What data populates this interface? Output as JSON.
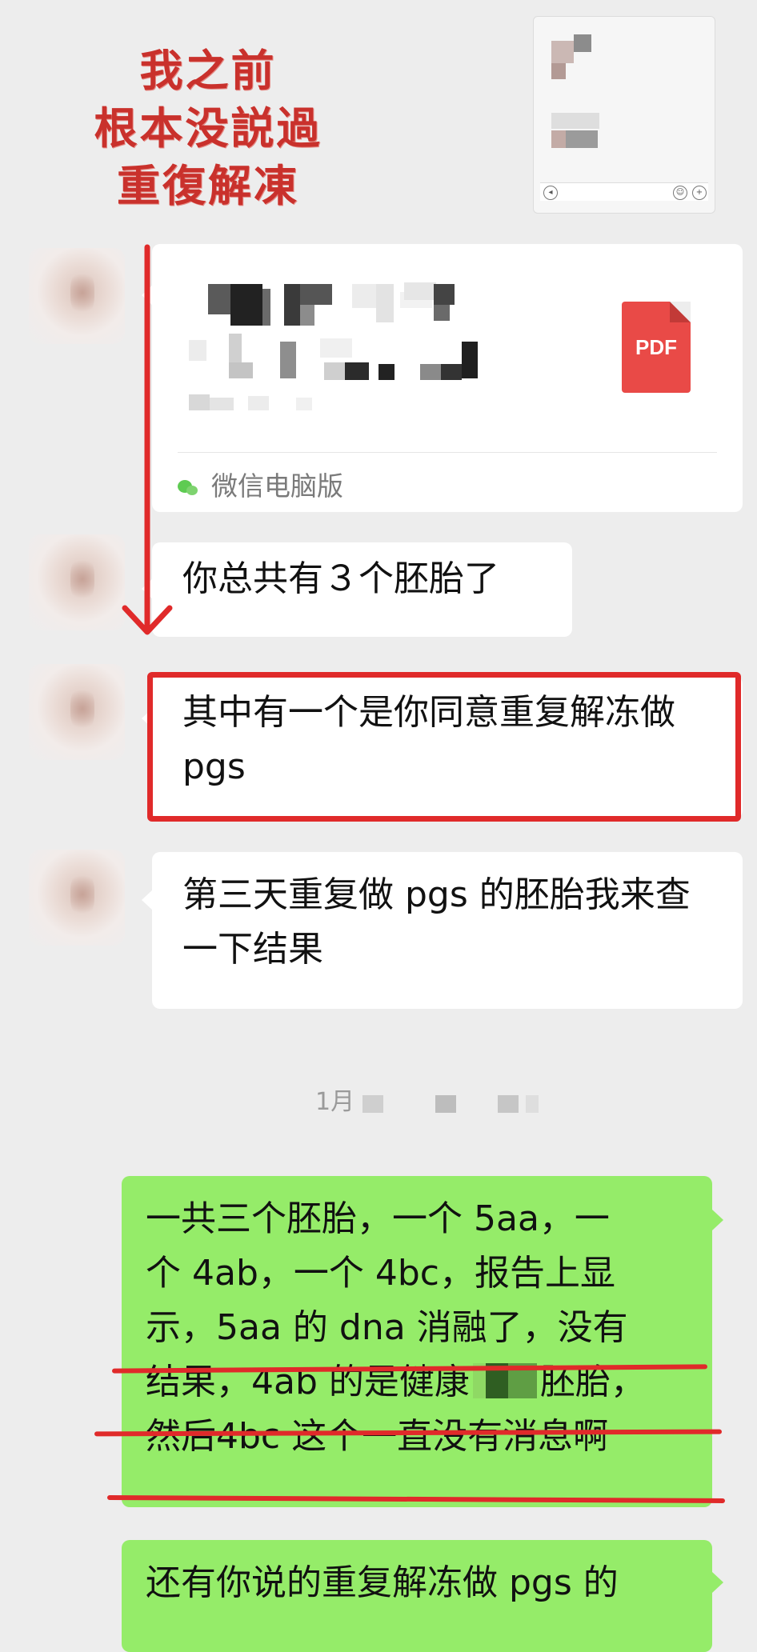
{
  "annotation": {
    "lines": [
      "我之前",
      "根本没説過",
      "重復解凍"
    ],
    "color": "#c9312c"
  },
  "file_message": {
    "icon": "pdf-icon",
    "icon_label": "PDF",
    "source_label": "微信电脑版",
    "source_icon": "wechat-icon"
  },
  "messages": [
    {
      "side": "left",
      "text": "你总共有３个胚胎了"
    },
    {
      "side": "left",
      "text": "其中有一个是你同意重复解冻做 pgs"
    },
    {
      "side": "left",
      "text": "第三天重复做 pgs 的胚胎我来查一下结果"
    }
  ],
  "timestamp": {
    "text": "1月"
  },
  "sent": {
    "msg1_lines": [
      "一共三个胚胎，一个 5aa，一",
      "个 4ab，一个 4bc，报告上显",
      "示，5aa 的 dna 消融了，没有",
      "结果，4ab 的是健康",
      "胚胎，",
      "然后4bc 这个一直没有消息啊"
    ],
    "msg2_text": "还有你说的重复解冻做 pgs 的"
  },
  "colors": {
    "background": "#ededed",
    "sent_bubble": "#95ec69",
    "received_bubble": "#ffffff",
    "highlight": "#e02a2a",
    "pdf": "#e94a47"
  }
}
